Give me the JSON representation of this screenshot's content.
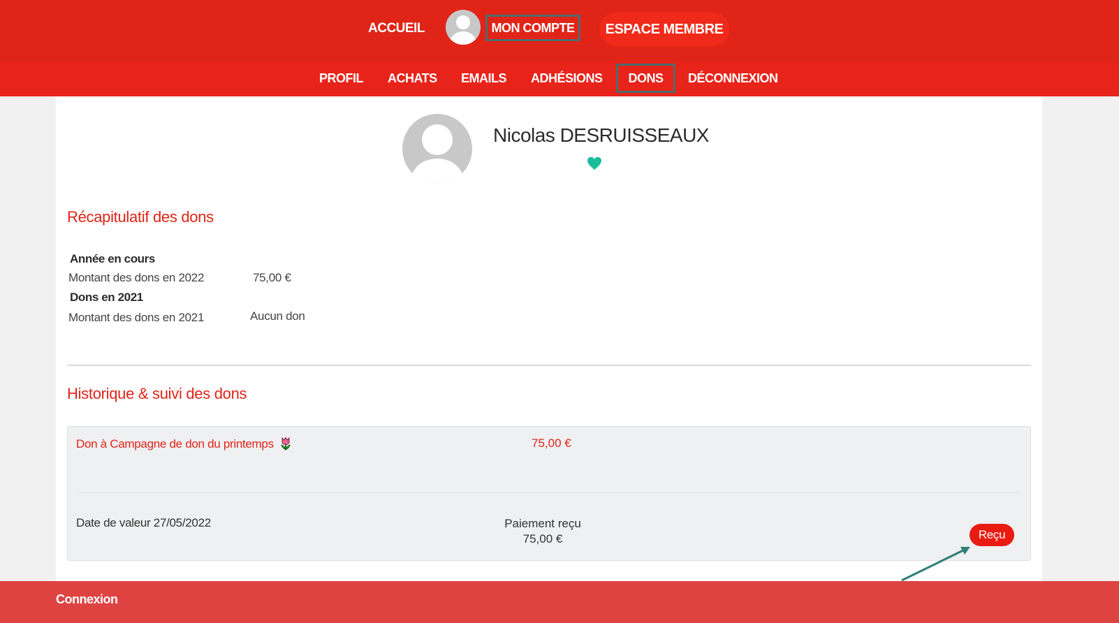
{
  "top_nav": {
    "accueil": "ACCUEIL",
    "mon_compte": "MON COMPTE",
    "espace_membre": "ESPACE MEMBRE"
  },
  "sub_nav": {
    "profil": "PROFIL",
    "achats": "ACHATS",
    "emails": "EMAILS",
    "adhesions": "ADHÉSIONS",
    "dons": "DONS",
    "deconnexion": "DÉCONNEXION"
  },
  "profile": {
    "name": "Nicolas DESRUISSEAUX",
    "heart_color": "#1abc9c"
  },
  "recap": {
    "title": "Récapitulatif des dons",
    "current_year_label": "Année en cours",
    "current_amount_label": "Montant des dons en 2022",
    "current_amount_value": "75,00 €",
    "previous_year_label": "Dons en 2021",
    "previous_amount_label": "Montant des dons en 2021",
    "previous_amount_value": "Aucun don"
  },
  "history": {
    "title": "Historique & suivi des dons",
    "donations": [
      {
        "title": "Don à Campagne de don du printemps",
        "icon": "tulip-icon",
        "amount": "75,00 €",
        "date": "Date de valeur 27/05/2022",
        "status": "Paiement reçu",
        "status_amount": "75,00 €",
        "receipt_label": "Reçu"
      }
    ]
  },
  "footer": {
    "connexion": "Connexion"
  },
  "colors": {
    "brand_red": "#e02418",
    "highlight_border": "#4f6a6a",
    "footer_red": "#de4342"
  }
}
